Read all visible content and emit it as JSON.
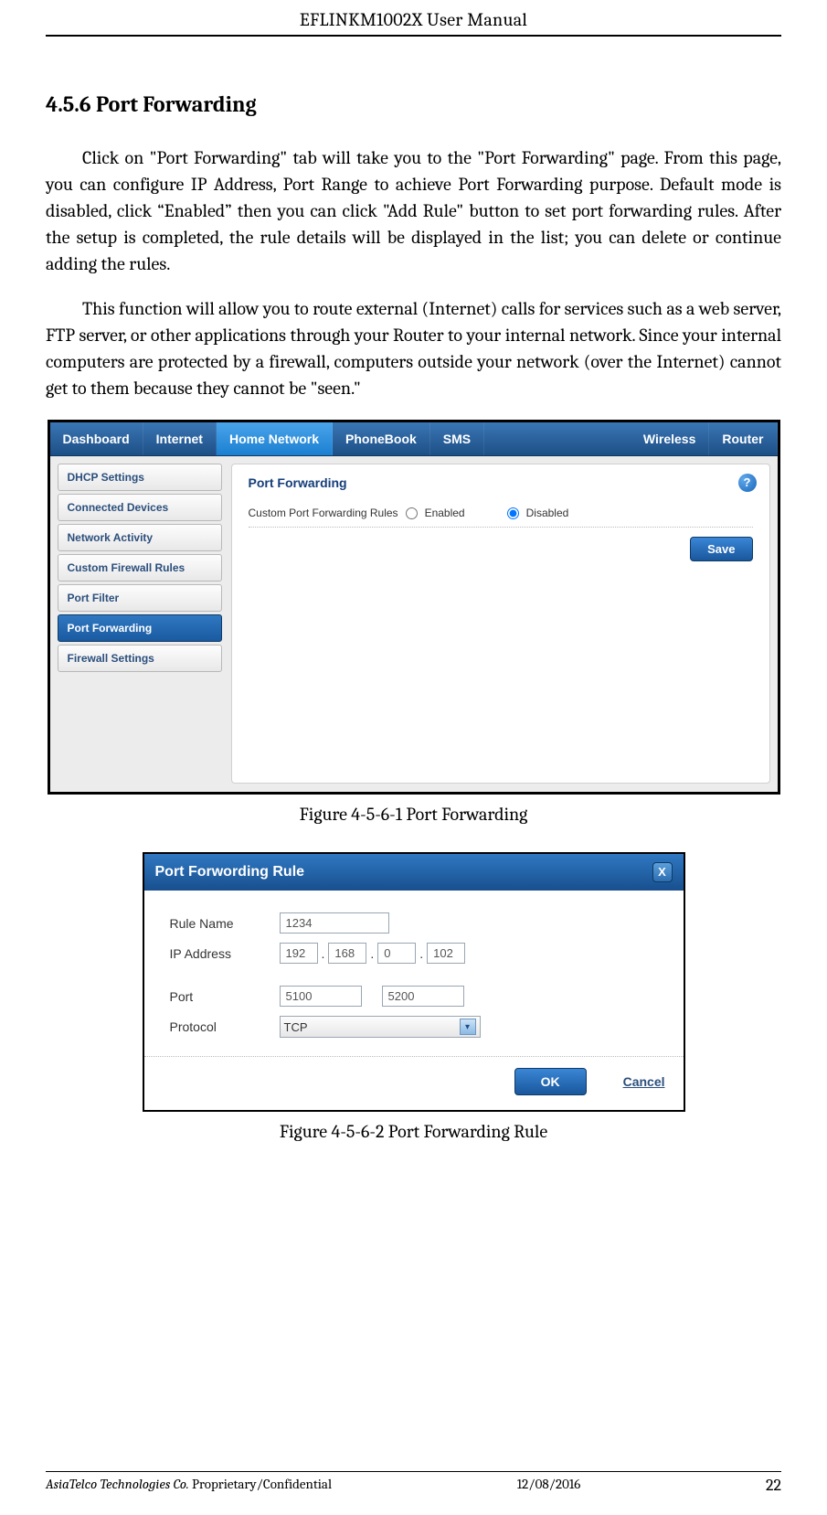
{
  "header": {
    "title": "EFLINKM1002X User Manual"
  },
  "section": {
    "number": "4.5.6",
    "title": "Port Forwarding"
  },
  "paragraphs": {
    "p1": "Click on \"Port Forwarding\" tab will take you to the \"Port Forwarding\" page. From this page, you can configure IP Address, Port Range to achieve Port Forwarding purpose. Default mode is disabled, click “Enabled” then you can click \"Add Rule\" button to set port forwarding rules. After the setup is completed, the rule details will be displayed in the list; you can delete or continue adding the rules.",
    "p2": "This function will allow you to route external (Internet) calls for services such as a web server, FTP server, or other applications through your Router to your internal network. Since your internal computers are protected by a firewall, computers outside your network (over the Internet) cannot get to them because they cannot be \"seen.\""
  },
  "shot1": {
    "nav": {
      "dashboard": "Dashboard",
      "internet": "Internet",
      "home_network": "Home Network",
      "phonebook": "PhoneBook",
      "sms": "SMS",
      "wireless": "Wireless",
      "router": "Router"
    },
    "sidebar": {
      "dhcp": "DHCP Settings",
      "connected": "Connected Devices",
      "network_activity": "Network Activity",
      "custom_firewall": "Custom Firewall Rules",
      "port_filter": "Port Filter",
      "port_forwarding": "Port Forwarding",
      "firewall_settings": "Firewall Settings"
    },
    "panel": {
      "title": "Port Forwarding",
      "help": "?",
      "rules_label": "Custom Port Forwarding Rules",
      "enabled": "Enabled",
      "disabled": "Disabled",
      "save": "Save"
    }
  },
  "caption1": "Figure 4-5-6-1 Port Forwarding",
  "shot2": {
    "title": "Port Forwording Rule",
    "close": "X",
    "labels": {
      "rule_name": "Rule Name",
      "ip_address": "IP Address",
      "port": "Port",
      "protocol": "Protocol"
    },
    "values": {
      "rule_name": "1234",
      "ip1": "192",
      "ip2": "168",
      "ip3": "0",
      "ip4": "102",
      "port_from": "5100",
      "port_to": "5200",
      "protocol": "TCP"
    },
    "buttons": {
      "ok": "OK",
      "cancel": "Cancel"
    }
  },
  "caption2": "Figure 4-5-6-2 Port Forwarding Rule",
  "footer": {
    "company": "AsiaTelco Technologies Co.",
    "confidential": " Proprietary/Confidential",
    "date": "12/08/2016",
    "page": "22"
  }
}
